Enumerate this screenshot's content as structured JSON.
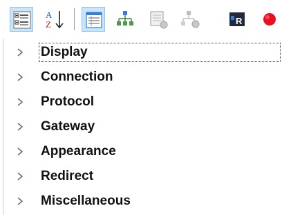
{
  "toolbar": {
    "buttons": [
      {
        "name": "categorized-view-button",
        "icon": "categorized-icon",
        "active": true
      },
      {
        "name": "sort-az-button",
        "icon": "sort-az-icon",
        "active": false
      },
      {
        "name": "properties-view-button",
        "icon": "properties-grid-icon",
        "active": true
      },
      {
        "name": "hierarchy-button",
        "icon": "hierarchy-icon",
        "active": false
      },
      {
        "name": "properties-disabled-button",
        "icon": "properties-disabled-icon",
        "active": false
      },
      {
        "name": "hierarchy-disabled-button",
        "icon": "hierarchy-disabled-icon",
        "active": false
      },
      {
        "name": "remote-app-button",
        "icon": "remote-app-icon",
        "active": false
      },
      {
        "name": "record-button",
        "icon": "record-icon",
        "active": false
      }
    ],
    "sort_icon_letters": {
      "top": "A",
      "bottom": "Z"
    },
    "remote_icon_letter": "R"
  },
  "categories": [
    {
      "label": "Display",
      "focused": true
    },
    {
      "label": "Connection",
      "focused": false
    },
    {
      "label": "Protocol",
      "focused": false
    },
    {
      "label": "Gateway",
      "focused": false
    },
    {
      "label": "Appearance",
      "focused": false
    },
    {
      "label": "Redirect",
      "focused": false
    },
    {
      "label": "Miscellaneous",
      "focused": false
    }
  ],
  "colors": {
    "active_button_bg": "#cce4f7",
    "record_red": "#e81123",
    "text": "#111111"
  }
}
